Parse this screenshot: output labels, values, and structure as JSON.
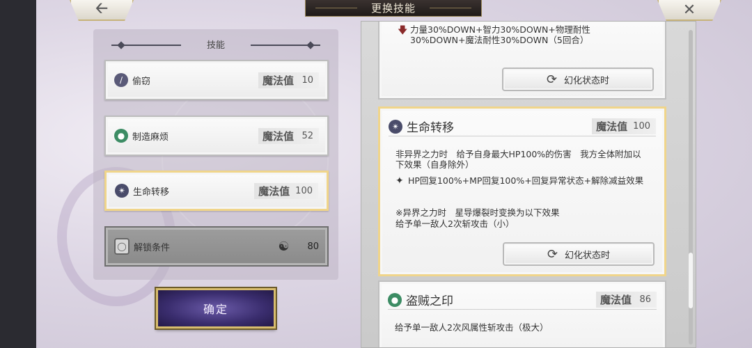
{
  "header": {
    "title": "更换技能",
    "back_icon": "back-arrow-icon",
    "close_icon": "close-icon"
  },
  "left_panel": {
    "heading": "技能",
    "skills": [
      {
        "name": "偷窃",
        "mp_label": "魔法值",
        "mp_value": "10",
        "icon": "steal-icon",
        "selected": false
      },
      {
        "name": "制造麻烦",
        "mp_label": "魔法值",
        "mp_value": "52",
        "icon": "green-orb-icon",
        "selected": false
      },
      {
        "name": "生命转移",
        "mp_label": "魔法值",
        "mp_value": "100",
        "icon": "star-burst-icon",
        "selected": true
      }
    ],
    "unlock": {
      "label": "解锁条件",
      "icon": "unlock-glyph-icon",
      "value": "80"
    },
    "confirm_label": "确定"
  },
  "right_panel": {
    "cards": [
      {
        "effect": "力量30%DOWN+智力30%DOWN+物理耐性30%DOWN+魔法耐性30%DOWN（5回合）",
        "button": "幻化状态时"
      },
      {
        "title": "生命转移",
        "mp_label": "魔法值",
        "mp_value": "100",
        "desc1": "非异界之力时　给予自身最大HP100%的伤害　我方全体附加以下效果（自身除外）",
        "effect": "HP回复100%+MP回复100%+回复异常状态+解除减益效果",
        "desc2a": "※异界之力时　星导爆裂时变换为以下效果",
        "desc2b": "给予单一敌人2次斩攻击（小）",
        "button": "幻化状态时"
      },
      {
        "title": "盗贼之印",
        "mp_label": "魔法值",
        "mp_value": "86",
        "desc1": "给予单一敌人2次风属性斩攻击（极大）"
      }
    ]
  },
  "colors": {
    "selected_border": "#f0d58a",
    "confirm_bg": "#3a2d6e",
    "title_plate": "#2a2321"
  }
}
